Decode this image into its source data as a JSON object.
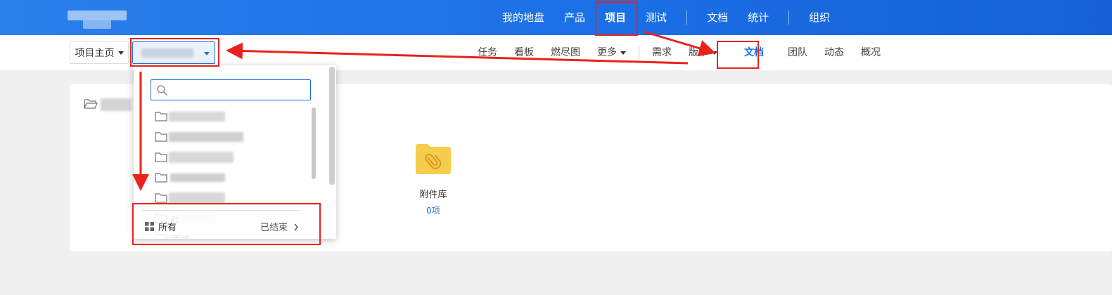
{
  "topnav": {
    "items": [
      "我的地盘",
      "产品",
      "项目",
      "测试",
      "文档",
      "统计",
      "组织"
    ],
    "active_index": 2
  },
  "subbar": {
    "home_label": "项目主页",
    "nav": [
      "任务",
      "看板",
      "燃尽图",
      "更多",
      "需求",
      "版本",
      "文档",
      "团队",
      "动态",
      "概况"
    ],
    "active_index": 6
  },
  "dropdown": {
    "search_value": "",
    "items": [
      "",
      "",
      "",
      "",
      "",
      "社",
      "商城"
    ],
    "footer": {
      "all_label": "所有",
      "done_label": "已结束"
    }
  },
  "main": {
    "library": {
      "name": "附件库",
      "count": "0项"
    }
  },
  "colors": {
    "topbar": "#1b6fe5",
    "accent": "#1a6fe5",
    "annotation": "#e8231b",
    "folder": "#f5cd4c"
  },
  "icons": [
    "search-icon",
    "folder-icon",
    "folder-open-icon",
    "grid-icon",
    "chevron-right-icon",
    "caret-down-icon",
    "paperclip-icon"
  ]
}
